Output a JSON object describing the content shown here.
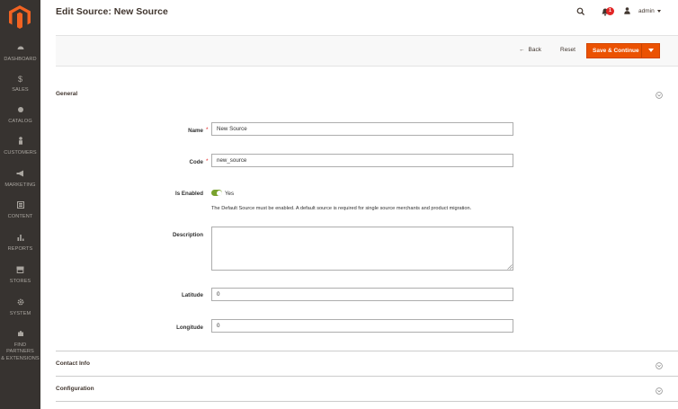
{
  "page": {
    "title": "Edit Source: New Source"
  },
  "sidebar": {
    "items": [
      {
        "label": "DASHBOARD",
        "icon": "dashboard-icon"
      },
      {
        "label": "SALES",
        "icon": "dollar-icon"
      },
      {
        "label": "CATALOG",
        "icon": "cube-icon"
      },
      {
        "label": "CUSTOMERS",
        "icon": "person-icon"
      },
      {
        "label": "MARKETING",
        "icon": "megaphone-icon"
      },
      {
        "label": "CONTENT",
        "icon": "layout-icon"
      },
      {
        "label": "REPORTS",
        "icon": "bar-chart-icon"
      },
      {
        "label": "STORES",
        "icon": "storefront-icon"
      },
      {
        "label": "SYSTEM",
        "icon": "gear-icon"
      },
      {
        "label1": "FIND PARTNERS",
        "label2": "& EXTENSIONS",
        "icon": "puzzle-icon"
      }
    ]
  },
  "header": {
    "notification_count": "1",
    "user_name": "admin"
  },
  "actions": {
    "back_label": "Back",
    "reset_label": "Reset",
    "save_label": "Save & Continue"
  },
  "sections": {
    "general": "General",
    "contact_info": "Contact Info",
    "configuration": "Configuration"
  },
  "form": {
    "name_label": "Name",
    "name_value": "New Source",
    "code_label": "Code",
    "code_value": "new_source",
    "enabled_label": "Is Enabled",
    "enabled_value": "Yes",
    "enabled_note": "The Default Source must be enabled. A default source is required for single source merchants and product migration.",
    "description_label": "Description",
    "description_value": "",
    "latitude_label": "Latitude",
    "latitude_value": "0",
    "longitude_label": "Longitude",
    "longitude_value": "0"
  },
  "colors": {
    "sidebar_bg": "#373330",
    "accent": "#eb5202",
    "toggle_on": "#79a22e",
    "required": "#e22626"
  }
}
